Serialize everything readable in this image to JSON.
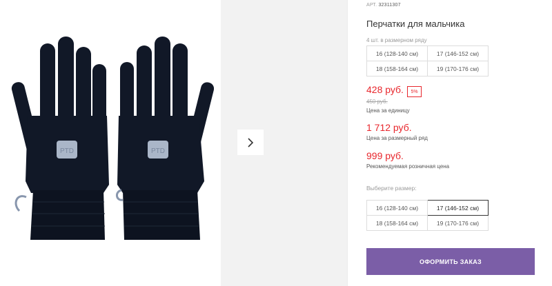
{
  "gallery": {
    "next_icon": "chevron-right-icon",
    "image_logo_text": "PTD"
  },
  "product": {
    "sku_label": "АРТ.",
    "sku_value": "32311307",
    "title": "Перчатки для мальчика",
    "pack_note": "4 шт. в размерном ряду",
    "pack_sizes": [
      [
        "16 (128-140 см)",
        "17 (146-152 см)"
      ],
      [
        "18 (158-164 см)",
        "19 (170-176 см)"
      ]
    ]
  },
  "pricing": {
    "price": "428 руб.",
    "discount": "5%",
    "old_price": "450 руб.",
    "unit_label": "Цена за единицу",
    "pack_price": "1 712 руб.",
    "pack_label": "Цена за размерный ряд",
    "rrp": "999 руб.",
    "rrp_label": "Рекомендуемая розничная цена",
    "accent_color": "#e8262c"
  },
  "size_selector": {
    "label": "Выберите размер:",
    "options": [
      [
        "16 (128-140 см)",
        "17 (146-152 см)"
      ],
      [
        "18 (158-164 см)",
        "19 (170-176 см)"
      ]
    ],
    "selected": "17 (146-152 см)"
  },
  "order_button": {
    "label": "ОФОРМИТЬ ЗАКАЗ",
    "color": "#7b5ea7"
  }
}
